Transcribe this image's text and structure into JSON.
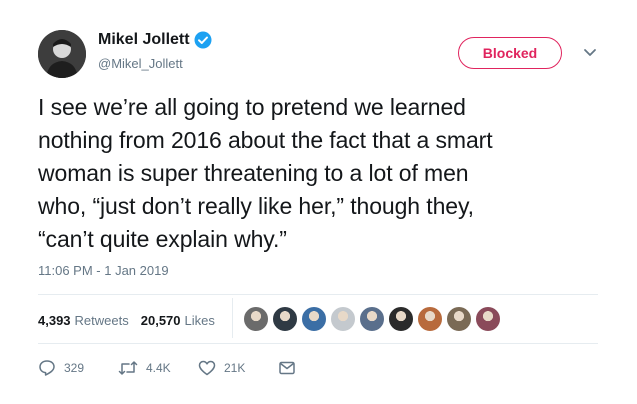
{
  "tweet": {
    "author_name": "Mikel Jollett",
    "author_handle": "@Mikel_Jollett",
    "verified": true,
    "follow_state_label": "Blocked",
    "text": "I see we’re all going to pretend we learned\nnothing from 2016 about the fact that a smart\nwoman is super threatening to a lot of men\nwho, “just don’t really like her,” though they,\n“can’t quite explain why.”",
    "timestamp": "11:06 PM - 1 Jan 2019"
  },
  "stats": {
    "retweets_count": "4,393",
    "retweets_label": "Retweets",
    "likes_count": "20,570",
    "likes_label": "Likes"
  },
  "likers": [
    {
      "icon": "liker-avatar",
      "color": "#6b6b6b"
    },
    {
      "icon": "liker-avatar",
      "color": "#2f3a44"
    },
    {
      "icon": "liker-avatar",
      "color": "#3b6ea5"
    },
    {
      "icon": "liker-avatar",
      "color": "#c4c9ce"
    },
    {
      "icon": "liker-avatar",
      "color": "#5a6f8c"
    },
    {
      "icon": "liker-avatar",
      "color": "#2b2b2b"
    },
    {
      "icon": "liker-avatar",
      "color": "#b86a3c"
    },
    {
      "icon": "liker-avatar",
      "color": "#7a6a55"
    },
    {
      "icon": "liker-avatar",
      "color": "#8a4a5a"
    }
  ],
  "actions": {
    "reply_count": "329",
    "retweet_count": "4.4K",
    "like_count": "21K"
  },
  "colors": {
    "accent_blocked": "#e0245e",
    "verified_blue": "#1da1f2",
    "secondary_text": "#657786"
  }
}
